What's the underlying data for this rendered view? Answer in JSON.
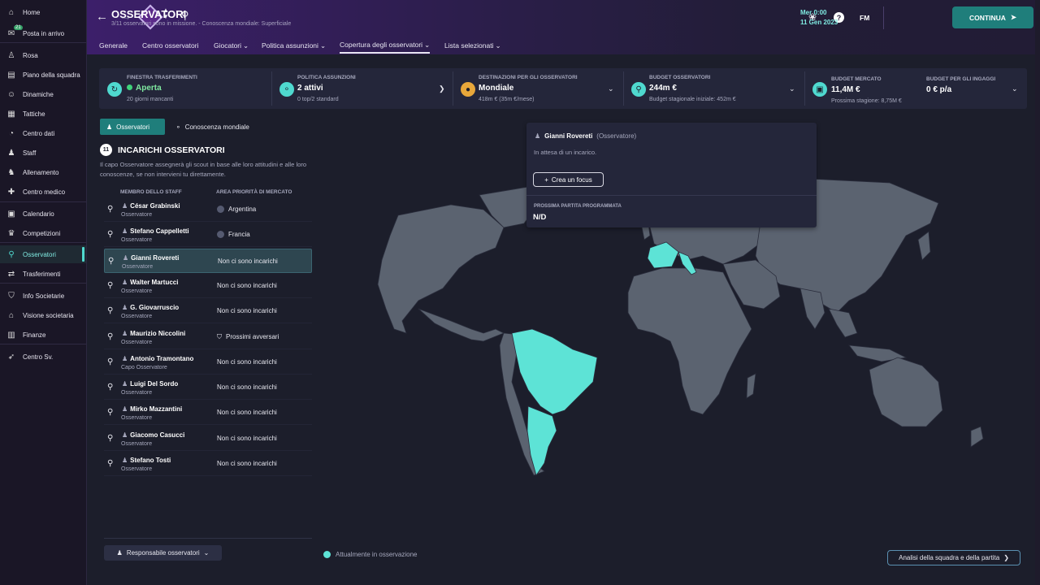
{
  "sidebar": {
    "items": [
      {
        "label": "Home",
        "icon": "home-icon"
      },
      {
        "label": "Posta in arrivo",
        "icon": "inbox-icon",
        "badge": "21"
      },
      {
        "label": "Rosa",
        "icon": "shirt-icon"
      },
      {
        "label": "Piano della squadra",
        "icon": "clipboard-icon"
      },
      {
        "label": "Dinamiche",
        "icon": "dynamics-icon"
      },
      {
        "label": "Tattiche",
        "icon": "tactics-icon"
      },
      {
        "label": "Centro dati",
        "icon": "data-icon"
      },
      {
        "label": "Staff",
        "icon": "staff-icon"
      },
      {
        "label": "Allenamento",
        "icon": "training-icon"
      },
      {
        "label": "Centro medico",
        "icon": "medical-icon"
      },
      {
        "label": "Calendario",
        "icon": "calendar-icon"
      },
      {
        "label": "Competizioni",
        "icon": "trophy-icon"
      },
      {
        "label": "Osservatori",
        "icon": "search-icon",
        "active": true
      },
      {
        "label": "Trasferimenti",
        "icon": "transfer-icon"
      },
      {
        "label": "Info Societarie",
        "icon": "shield-icon"
      },
      {
        "label": "Visione societaria",
        "icon": "bank-icon"
      },
      {
        "label": "Finanze",
        "icon": "finance-icon"
      },
      {
        "label": "Centro Sv.",
        "icon": "dev-icon"
      }
    ]
  },
  "header": {
    "title": "OSSERVATORI",
    "subtitle": "3/11 osservatori sono in missione. - Conoscenza mondiale: Superficiale",
    "date_line1": "Mer 0:00",
    "date_line2": "11 Gen 2023",
    "fm": "FM",
    "continue_label": "CONTINUA"
  },
  "tabs": [
    "Generale",
    "Centro osservatori",
    "Giocatori",
    "Politica assunzioni",
    "Copertura degli osservatori",
    "Lista selezionati"
  ],
  "infobar": {
    "transfer": {
      "label": "FINESTRA TRASFERIMENTI",
      "value": "Aperta",
      "sub": "20 giorni mancanti"
    },
    "hiring": {
      "label": "POLITICA ASSUNZIONI",
      "value": "2 attivi",
      "sub": "0 top/2 standard"
    },
    "destinations": {
      "label": "DESTINAZIONI PER GLI OSSERVATORI",
      "value": "Mondiale",
      "sub": "418m € (35m €/mese)"
    },
    "budget": {
      "label": "BUDGET OSSERVATORI",
      "value": "244m €",
      "sub": "Budget stagionale iniziale: 452m €"
    },
    "market": {
      "label": "BUDGET MERCATO",
      "value": "11,4M €",
      "sub": "Prossima stagione: 8,75M €"
    },
    "wages": {
      "label": "BUDGET PER GLI INGAGGI",
      "value": "0 € p/a"
    }
  },
  "toggle": {
    "scouts": "Osservatori",
    "knowledge": "Conoscenza mondiale"
  },
  "section": {
    "count": "11",
    "title": "INCARICHI OSSERVATORI",
    "description": "Il capo Osservatore assegnerà gli scout in base alle loro attitudini e alle loro conoscenze, se non intervieni tu direttamente.",
    "col_staff": "MEMBRO DELLO STAFF",
    "col_area": "AREA PRIORITÀ DI MERCATO"
  },
  "scouts": [
    {
      "name": "César Grabinski",
      "role": "Osservatore",
      "area": "Argentina",
      "flag": true
    },
    {
      "name": "Stefano Cappelletti",
      "role": "Osservatore",
      "area": "Francia",
      "flag": true
    },
    {
      "name": "Gianni Rovereti",
      "role": "Osservatore",
      "area": "Non ci sono incarichi",
      "selected": true
    },
    {
      "name": "Walter Martucci",
      "role": "Osservatore",
      "area": "Non ci sono incarichi"
    },
    {
      "name": "G. Giovarruscio",
      "role": "Osservatore",
      "area": "Non ci sono incarichi"
    },
    {
      "name": "Maurizio Niccolini",
      "role": "Osservatore",
      "area": "Prossimi avversari",
      "shield": true
    },
    {
      "name": "Antonio Tramontano",
      "role": "Capo Osservatore",
      "area": "Non ci sono incarichi"
    },
    {
      "name": "Luigi Del Sordo",
      "role": "Osservatore",
      "area": "Non ci sono incarichi"
    },
    {
      "name": "Mirko Mazzantini",
      "role": "Osservatore",
      "area": "Non ci sono incarichi"
    },
    {
      "name": "Giacomo Casucci",
      "role": "Osservatore",
      "area": "Non ci sono incarichi"
    },
    {
      "name": "Stefano Tosti",
      "role": "Osservatore",
      "area": "Non ci sono incarichi"
    }
  ],
  "popup": {
    "name": "Gianni Rovereti",
    "role": "(Osservatore)",
    "status": "In attesa di un incarico.",
    "focus_button": "Crea un focus",
    "next_match_label": "PROSSIMA PARTITA PROGRAMMATA",
    "next_match_value": "N/D"
  },
  "footer": {
    "responsible": "Responsabile osservatori",
    "legend": "Attualmente in osservazione",
    "analysis": "Analisi della squadra e della partita"
  },
  "colors": {
    "accent": "#4fd9cf",
    "map_land": "#5b6370",
    "map_highlight": "#5de3d6",
    "bg": "#1c1e2b"
  }
}
